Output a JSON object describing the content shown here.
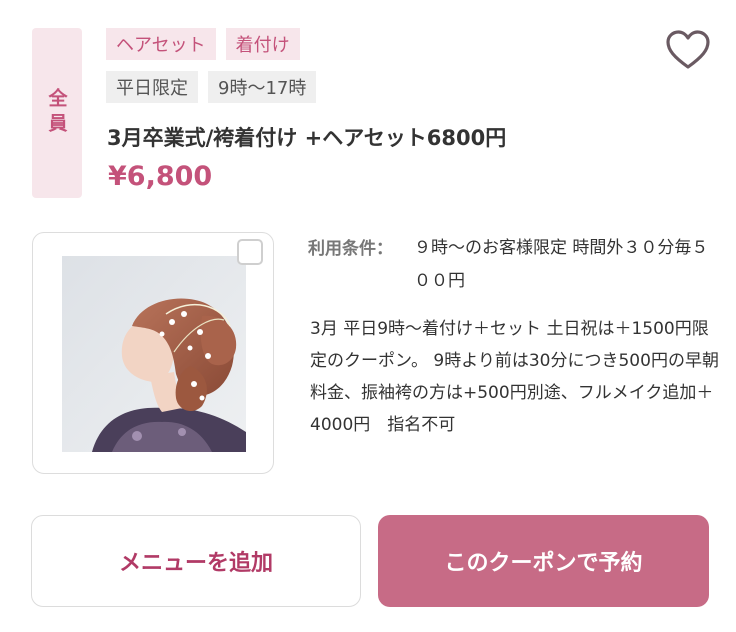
{
  "coupon": {
    "target": "全員",
    "categories": [
      "ヘアセット",
      "着付け"
    ],
    "conditions": [
      "平日限定",
      "9時〜17時"
    ],
    "title": "3月卒業式/袴着付け +ヘアセット6800円",
    "price": "¥6,800",
    "usage_label": "利用条件：",
    "usage_text": "９時〜のお客様限定 時間外３０分毎５００円",
    "description": "3月 平日9時〜着付け＋セット 土日祝は＋1500円限定のクーポン。 9時より前は30分につき500円の早朝料金、振袖袴の方は+500円別途、フルメイク追加＋4000円　指名不可"
  },
  "icons": {
    "favorite": "heart-outline-icon",
    "select": "checkbox-icon"
  },
  "actions": {
    "add_menu": "メニューを追加",
    "reserve": "このクーポンで予約"
  },
  "colors": {
    "accent": "#c4527a",
    "button": "#c76b86",
    "tag_bg": "#f7e6eb",
    "condition_bg": "#efefef"
  }
}
